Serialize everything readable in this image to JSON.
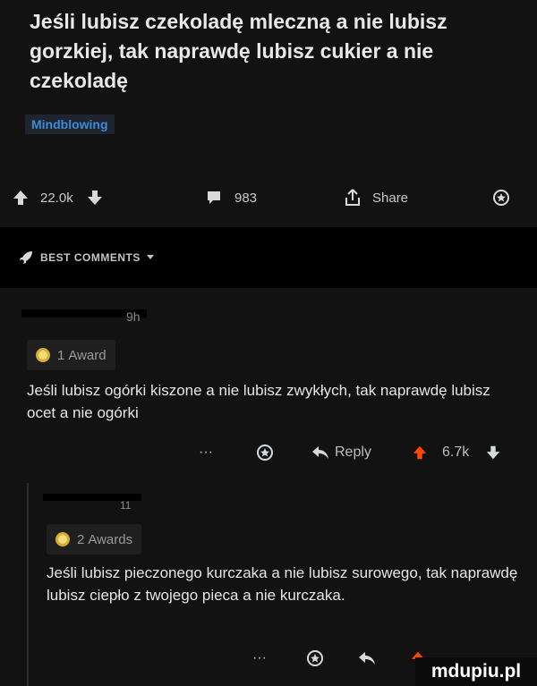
{
  "post": {
    "title": "Jeśli lubisz czekoladę mleczną a nie lubisz gorzkiej, tak naprawdę lubisz cukier a nie czekoladę",
    "flair": "Mindblowing",
    "upvotes": "22.0k",
    "comments": "983",
    "share_label": "Share"
  },
  "sort": {
    "label": "BEST COMMENTS"
  },
  "comments": [
    {
      "author_suffix": "9h",
      "award_count": "1",
      "award_label": "Award",
      "text": "Jeśli lubisz ogórki kiszone a nie lubisz zwykłych, tak naprawdę lubisz ocet a nie ogórki",
      "more": "···",
      "reply_label": "Reply",
      "votes": "6.7k"
    },
    {
      "author_suffix": "11",
      "award_count": "2",
      "award_label": "Awards",
      "text": "Jeśli lubisz pieczonego kurczaka a nie lubisz surowego, tak naprawdę lubisz ciepło z twojego pieca a nie kurczaka.",
      "more": "···"
    }
  ],
  "watermark": "mdupiu.pl",
  "colors": {
    "upvote": "#ff4500",
    "flair": "#3d8bd6",
    "background": "#121212"
  }
}
